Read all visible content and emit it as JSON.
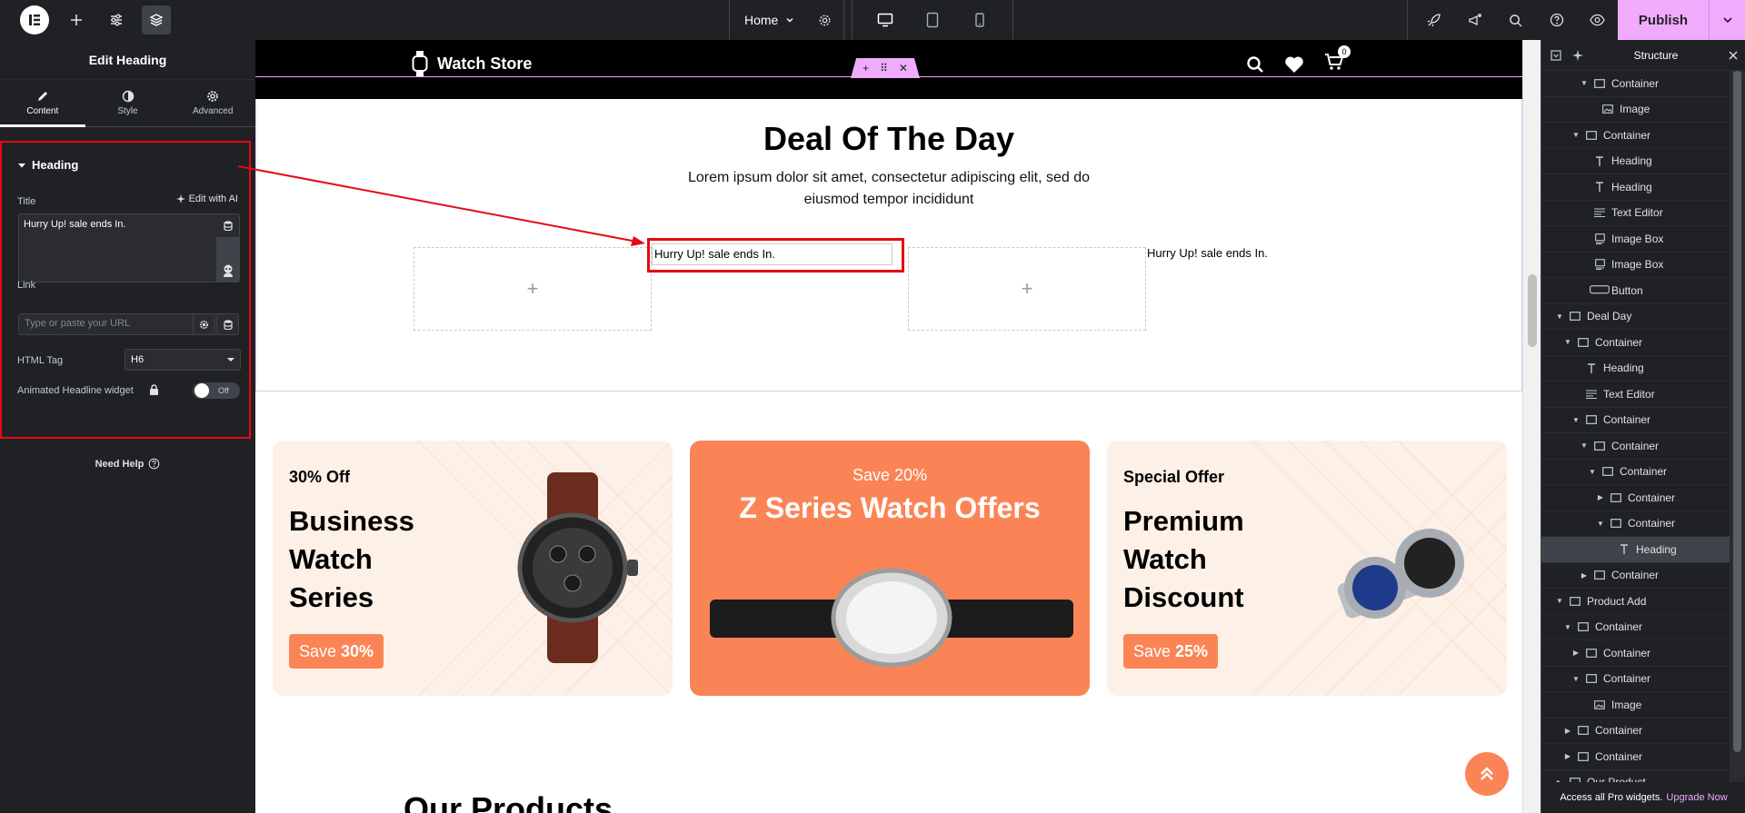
{
  "topbar": {
    "page_name": "Home",
    "publish_label": "Publish",
    "accent_color": "#f0abfc"
  },
  "left_panel": {
    "title": "Edit Heading",
    "tabs": [
      {
        "label": "Content",
        "icon": "pencil-icon"
      },
      {
        "label": "Style",
        "icon": "half-circle-icon"
      },
      {
        "label": "Advanced",
        "icon": "gear-icon"
      }
    ],
    "section_title": "Heading",
    "title_label": "Title",
    "edit_ai_label": "Edit with AI",
    "title_value": "Hurry Up! sale ends In.",
    "link_label": "Link",
    "link_placeholder": "Type or paste your URL",
    "html_tag_label": "HTML Tag",
    "html_tag_value": "H6",
    "animated_label": "Animated Headline widget",
    "toggle_state": "Off",
    "need_help": "Need Help"
  },
  "canvas": {
    "brand": "Watch Store",
    "cart_count": "0",
    "deal_title": "Deal Of The Day",
    "deal_sub": "Lorem ipsum dolor sit amet, consectetur adipiscing elit, sed do eiusmod tempor incididunt",
    "heading_selected": "Hurry Up! sale ends In.",
    "heading_plain": "Hurry Up! sale ends In.",
    "cards": [
      {
        "tag": "30% Off",
        "title": "Business Watch Series",
        "save_word": "Save",
        "save_value": "30%"
      },
      {
        "save_line": "Save 20%",
        "title": "Z Series Watch Offers"
      },
      {
        "tag": "Special Offer",
        "title": "Premium Watch Discount",
        "save_word": "Save",
        "save_value": "25%"
      }
    ],
    "products_title": "Our Products"
  },
  "structure": {
    "title": "Structure",
    "rows": [
      {
        "indent": 3,
        "caret": "down",
        "icon": "container-icon",
        "label": "Container"
      },
      {
        "indent": 4,
        "caret": "",
        "icon": "image-icon",
        "label": "Image"
      },
      {
        "indent": 2,
        "caret": "down",
        "icon": "container-icon",
        "label": "Container"
      },
      {
        "indent": 3,
        "caret": "",
        "icon": "heading-icon",
        "label": "Heading"
      },
      {
        "indent": 3,
        "caret": "",
        "icon": "heading-icon",
        "label": "Heading"
      },
      {
        "indent": 3,
        "caret": "",
        "icon": "text-editor-icon",
        "label": "Text Editor"
      },
      {
        "indent": 3,
        "caret": "",
        "icon": "image-box-icon",
        "label": "Image Box"
      },
      {
        "indent": 3,
        "caret": "",
        "icon": "image-box-icon",
        "label": "Image Box"
      },
      {
        "indent": 3,
        "caret": "",
        "icon": "button-icon",
        "label": "Button"
      },
      {
        "indent": 0,
        "caret": "down",
        "icon": "container-icon",
        "label": "Deal Day"
      },
      {
        "indent": 1,
        "caret": "down",
        "icon": "container-icon",
        "label": "Container"
      },
      {
        "indent": 2,
        "caret": "",
        "icon": "heading-icon",
        "label": "Heading"
      },
      {
        "indent": 2,
        "caret": "",
        "icon": "text-editor-icon",
        "label": "Text Editor"
      },
      {
        "indent": 2,
        "caret": "down",
        "icon": "container-icon",
        "label": "Container"
      },
      {
        "indent": 3,
        "caret": "down",
        "icon": "container-icon",
        "label": "Container"
      },
      {
        "indent": 4,
        "caret": "down",
        "icon": "container-icon",
        "label": "Container"
      },
      {
        "indent": 5,
        "caret": "right",
        "icon": "container-icon",
        "label": "Container"
      },
      {
        "indent": 5,
        "caret": "down",
        "icon": "container-icon",
        "label": "Container"
      },
      {
        "indent": 6,
        "caret": "",
        "icon": "heading-icon",
        "label": "Heading",
        "selected": true
      },
      {
        "indent": 3,
        "caret": "right",
        "icon": "container-icon",
        "label": "Container"
      },
      {
        "indent": 0,
        "caret": "down",
        "icon": "container-icon",
        "label": "Product Add"
      },
      {
        "indent": 1,
        "caret": "down",
        "icon": "container-icon",
        "label": "Container"
      },
      {
        "indent": 2,
        "caret": "right",
        "icon": "container-icon",
        "label": "Container"
      },
      {
        "indent": 2,
        "caret": "down",
        "icon": "container-icon",
        "label": "Container"
      },
      {
        "indent": 3,
        "caret": "",
        "icon": "image-icon",
        "label": "Image"
      },
      {
        "indent": 1,
        "caret": "right",
        "icon": "container-icon",
        "label": "Container"
      },
      {
        "indent": 1,
        "caret": "right",
        "icon": "container-icon",
        "label": "Container"
      },
      {
        "indent": 0,
        "caret": "right",
        "icon": "container-icon",
        "label": "Our Product"
      }
    ],
    "footer_text": "Access all Pro widgets.",
    "footer_link": "Upgrade Now"
  }
}
